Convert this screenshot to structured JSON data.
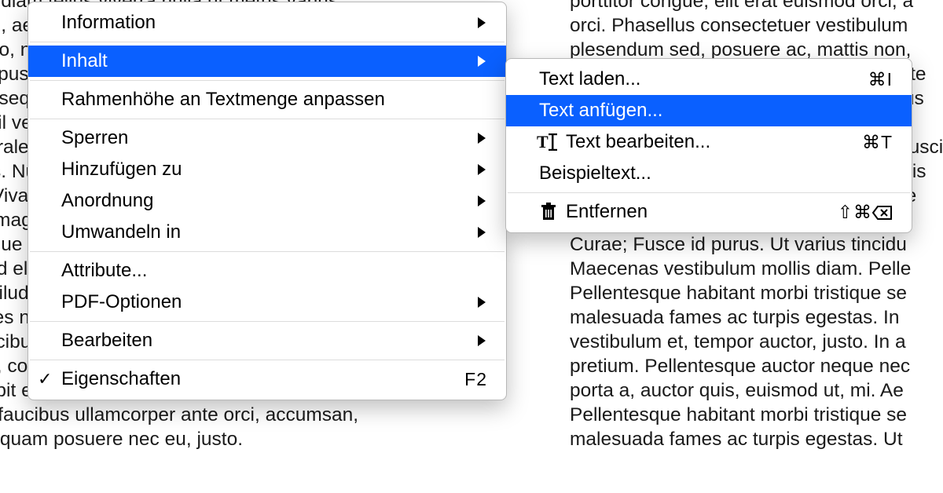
{
  "background": {
    "left": "a, tortor diam tellus viverra nulla ut metus varius\ne rutrum, aenean imperdiet. Etiam ultricies orci vel\nr ut libero, nec nullrioes nisl. Nam eget dui. Etiam\nnas tempus, tellus eget condimentum rhoncus, sem\nero, consequat id amet. Cras dapibus. Vivamus\ns, bumnil vel, luctus pulvinar, hendrerit id, lorem\nodio elorale nonduni tempus. Donec vitae sapien ut\nfaucibus. Nullam quis ante. Etiam sit amet orci eget\ncidunt. Vivamus diso fringilla mauris sit amet nibh.\nsagittis magna. Sed consequat, leo eget bibendum\nvelit augue velit cursus gravida magna mi a libero.\nelencend elesum. Vestibulum purus quam at\nnollis aviludum gui id, metus. Nullam accumsan\nis ultricies nisi vel hendrerit fringilla. Vestibulum\nis in faucibus orci luctus et ultrices posuere cubilia\nsit amet, consectetuer lacinia. Nam pretium turpis et\nor suscipit eget, imperdiet nec, imperdiet iaculis,\nuam in, faucibus ullamcorper ante orci, accumsan,\nid tortor quam posuere nec eu, justo.",
    "right": "porttitor congue, elit erat euismod orci, a\norci. Phasellus consectetuer vestibulum\nplesendum sed, posuere ac, mattis non,\nnunc ullamcorper augue, in turpis suilente\nauctor, lobortis posuere, tortor sed cursus\nfeugiat. In ultricacet dui quam nodur si\nsuscipit fringilla, libero nec, volutpat a, suscipit\nsuspendisse pulvinar, augue ac venenatis\ntincidunt. Cras nec pellentesque sit pede\nante ipsum primis in faucibus orci luctus\nCurae; Fusce id purus. Ut varius tincidu\nMaecenas vestibulum mollis diam. Pelle\nPellentesque habitant morbi tristique se\nmalesuada fames ac turpis egestas. In\nvestibulum et, tempor auctor, justo. In a\npretium. Pellentesque auctor neque nec\nporta a, auctor quis, euismod ut, mi. Ae\nPellentesque habitant morbi tristique se\nmalesuada fames ac turpis egestas. Ut"
  },
  "menu": {
    "information": "Information",
    "inhalt": "Inhalt",
    "rahmen": "Rahmenhöhe an Textmenge anpassen",
    "sperren": "Sperren",
    "hinzufuegen": "Hinzufügen zu",
    "anordnung": "Anordnung",
    "umwandeln": "Umwandeln in",
    "attribute": "Attribute...",
    "pdf": "PDF-Optionen",
    "bearbeiten": "Bearbeiten",
    "eigenschaften": "Eigenschaften",
    "eigenschaften_shortcut": "F2"
  },
  "submenu": {
    "text_laden": "Text laden...",
    "text_laden_shortcut": "⌘I",
    "text_anfuegen": "Text anfügen...",
    "text_bearbeiten": "Text bearbeiten...",
    "text_bearbeiten_shortcut": "⌘T",
    "beispieltext": "Beispieltext...",
    "entfernen": "Entfernen",
    "entfernen_shortcut": "⇧⌘"
  }
}
